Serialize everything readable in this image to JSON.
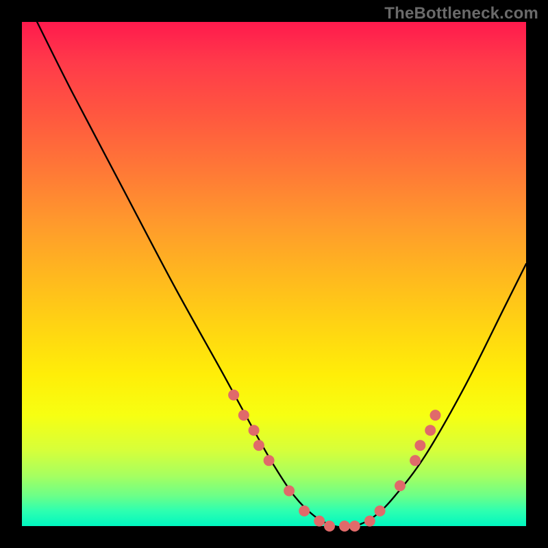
{
  "watermark": "TheBottleneck.com",
  "chart_data": {
    "type": "line",
    "title": "",
    "xlabel": "",
    "ylabel": "",
    "xlim": [
      0,
      100
    ],
    "ylim": [
      0,
      100
    ],
    "grid": false,
    "legend": false,
    "series": [
      {
        "name": "bottleneck-curve",
        "x": [
          3,
          10,
          20,
          30,
          40,
          46,
          50,
          54,
          58,
          62,
          66,
          70,
          74,
          80,
          88,
          96,
          100
        ],
        "y": [
          100,
          86,
          67,
          48,
          30,
          19,
          12,
          6,
          2,
          0,
          0,
          2,
          6,
          14,
          28,
          44,
          52
        ]
      }
    ],
    "markers": {
      "name": "highlight-dots",
      "color": "#e06a6a",
      "radius_px": 8,
      "points": [
        {
          "x": 42,
          "y": 26
        },
        {
          "x": 44,
          "y": 22
        },
        {
          "x": 46,
          "y": 19
        },
        {
          "x": 47,
          "y": 16
        },
        {
          "x": 49,
          "y": 13
        },
        {
          "x": 53,
          "y": 7
        },
        {
          "x": 56,
          "y": 3
        },
        {
          "x": 59,
          "y": 1
        },
        {
          "x": 61,
          "y": 0
        },
        {
          "x": 64,
          "y": 0
        },
        {
          "x": 66,
          "y": 0
        },
        {
          "x": 69,
          "y": 1
        },
        {
          "x": 71,
          "y": 3
        },
        {
          "x": 75,
          "y": 8
        },
        {
          "x": 78,
          "y": 13
        },
        {
          "x": 79,
          "y": 16
        },
        {
          "x": 81,
          "y": 19
        },
        {
          "x": 82,
          "y": 22
        }
      ]
    }
  },
  "colors": {
    "curve": "#000000",
    "marker": "#e06a6a",
    "background_frame": "#000000"
  }
}
